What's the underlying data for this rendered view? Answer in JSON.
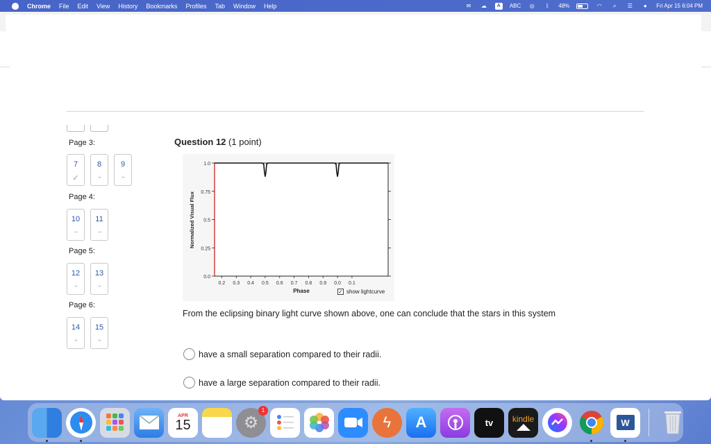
{
  "menubar": {
    "app": "Chrome",
    "menus": [
      "File",
      "Edit",
      "View",
      "History",
      "Bookmarks",
      "Profiles",
      "Tab",
      "Window",
      "Help"
    ],
    "input_source_badge": "A",
    "input_source": "ABC",
    "battery": "48%",
    "clock": "Fri Apr 15  6:04 PM"
  },
  "nav": {
    "pages": [
      {
        "label": "Page 3:",
        "questions": [
          {
            "number": "7",
            "status": "✓"
          },
          {
            "number": "8",
            "status": "--"
          },
          {
            "number": "9",
            "status": "--"
          }
        ]
      },
      {
        "label": "Page 4:",
        "questions": [
          {
            "number": "10",
            "status": "--"
          },
          {
            "number": "11",
            "status": "--"
          }
        ]
      },
      {
        "label": "Page 5:",
        "questions": [
          {
            "number": "12",
            "status": "--"
          },
          {
            "number": "13",
            "status": "--"
          }
        ]
      },
      {
        "label": "Page 6:",
        "questions": [
          {
            "number": "14",
            "status": "--"
          },
          {
            "number": "15",
            "status": "--"
          }
        ]
      }
    ]
  },
  "question": {
    "title": "Question 12",
    "points": "(1 point)",
    "prompt": "From the eclipsing binary light curve shown above, one can conclude that the stars in this system",
    "options": [
      "have a small separation compared to their radii.",
      "have a large  separation compared to their radii."
    ],
    "show_lightcurve_label": "show lightcurve"
  },
  "chart_data": {
    "type": "line",
    "xlabel": "Phase",
    "ylabel": "Normalized Visual Flux",
    "x_ticks": [
      "0.2",
      "0.3",
      "0.4",
      "0.5",
      "0.6",
      "0.7",
      "0.8",
      "0.9",
      "0.0",
      "0.1"
    ],
    "y_ticks": [
      "0.0",
      "0.25",
      "0.5",
      "0.75",
      "1.0"
    ],
    "ylim": [
      0,
      1.0
    ],
    "series": [
      {
        "x": [
          0.15,
          0.48,
          0.49,
          0.495,
          0.5,
          0.505,
          0.51,
          0.52,
          0.98,
          0.99,
          0.995,
          1.0,
          1.005,
          1.01,
          1.02,
          1.35
        ],
        "y": [
          1.0,
          1.0,
          0.99,
          0.92,
          0.88,
          0.92,
          0.99,
          1.0,
          1.0,
          0.99,
          0.92,
          0.88,
          0.92,
          0.99,
          1.0,
          1.0
        ]
      }
    ],
    "colors": {
      "curve": "#111111",
      "left_axis": "#cc2222"
    }
  },
  "dock": {
    "calendar_month": "APR",
    "calendar_day": "15",
    "settings_badge": "1",
    "tv_label": "tv",
    "kindle_label": "kindle",
    "word_letter": "W",
    "icons": [
      "finder-icon",
      "safari-icon",
      "launchpad-icon",
      "mail-icon",
      "calendar-icon",
      "notes-icon",
      "system-preferences-icon",
      "reminders-icon",
      "photos-icon",
      "zoom-icon",
      "spark-icon",
      "app-store-icon",
      "podcasts-icon",
      "apple-tv-icon",
      "kindle-icon",
      "messenger-icon",
      "chrome-icon",
      "word-icon",
      "trash-icon"
    ]
  }
}
